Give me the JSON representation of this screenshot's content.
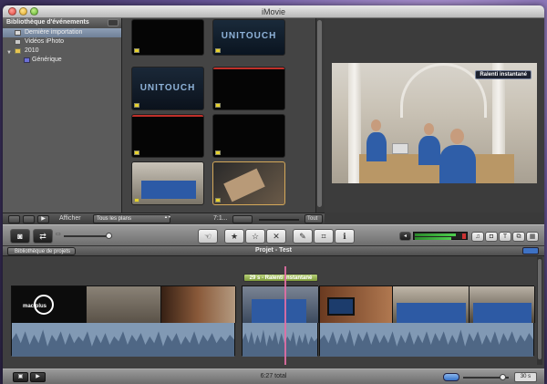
{
  "window": {
    "title": "iMovie"
  },
  "library": {
    "header": "Bibliothèque d'événements",
    "items": [
      {
        "label": "Dernière importation",
        "selected": true
      },
      {
        "label": "Vidéos iPhoto",
        "selected": false
      },
      {
        "label": "2010",
        "selected": false
      },
      {
        "label": "Générique",
        "selected": false
      }
    ]
  },
  "browser": {
    "thumb_text_1": "UNITOUCH",
    "thumb_text_2": "UNITOUCH"
  },
  "viewer": {
    "overlay_label": "Ralenti instantané"
  },
  "browser_bar": {
    "show_label": "Afficher",
    "filter_value": "Tous les plans",
    "zoom_value": "7:1...",
    "all_label": "Tout"
  },
  "project": {
    "back_label": "Bibliothèque de projets",
    "title": "Projet - Test",
    "clip_label": "29 s - Ralenti instantané",
    "frame_text": "mac plus"
  },
  "status": {
    "total": "6:27 total",
    "zoom_seconds": "30 s"
  },
  "colors": {
    "accent": "#3874c9",
    "playhead": "#e26ea4",
    "clip_label": "#9ab55a"
  }
}
